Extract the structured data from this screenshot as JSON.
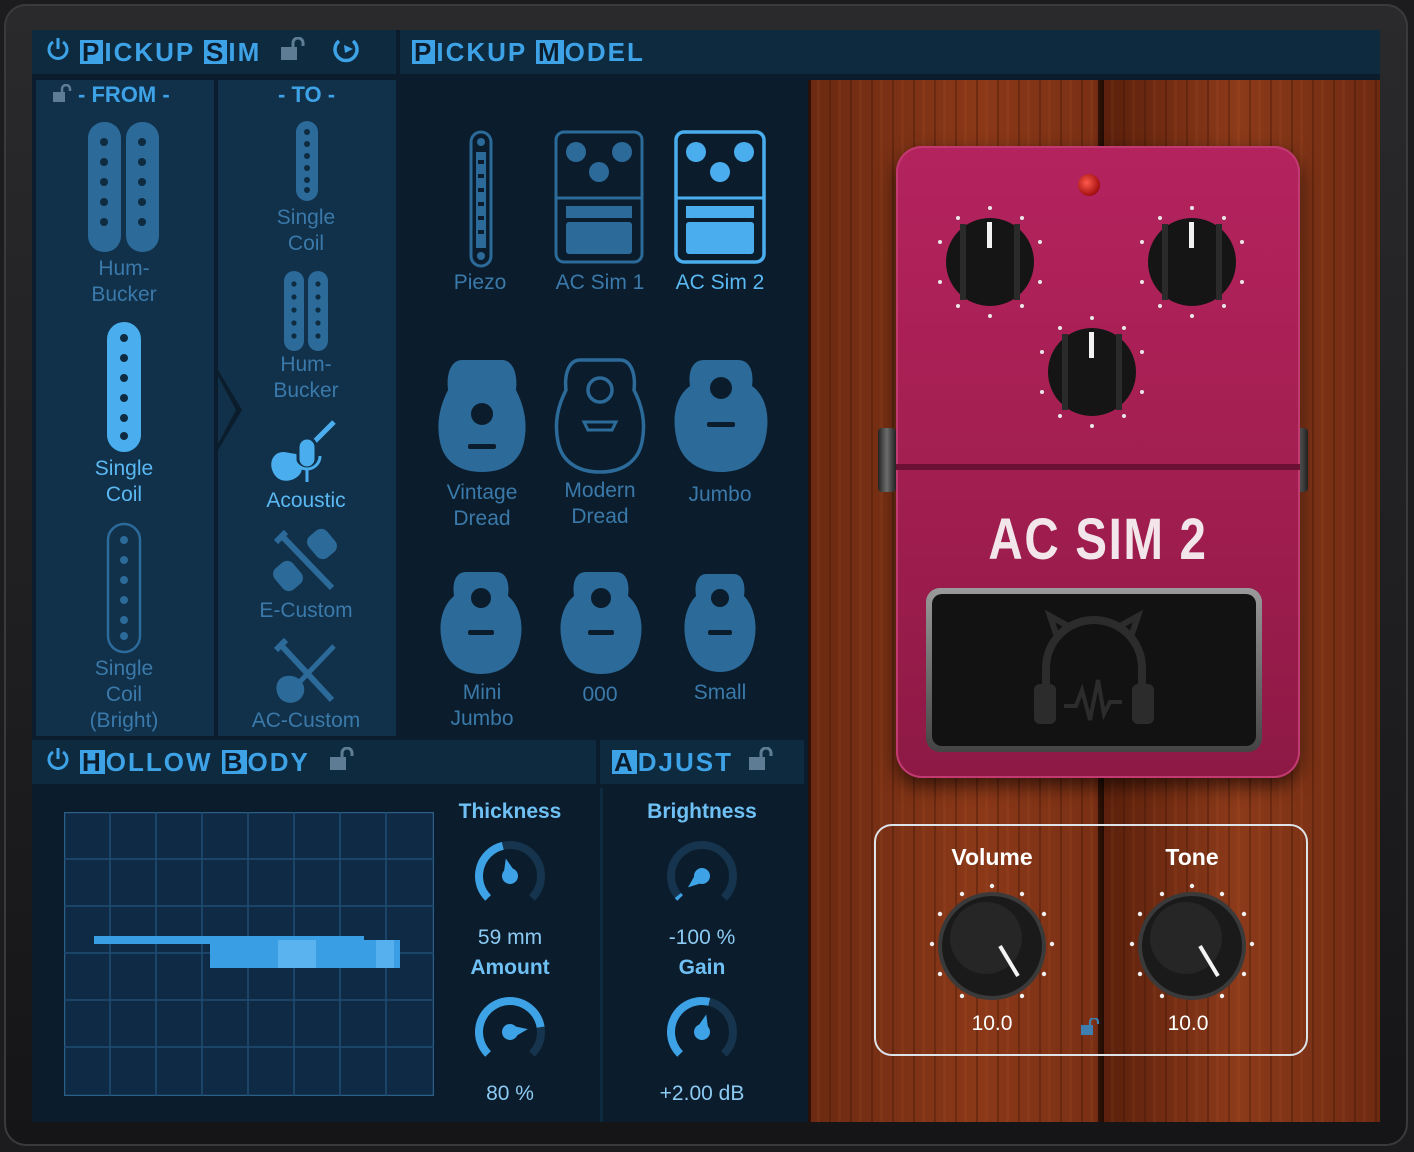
{
  "pickup_sim": {
    "title_cap1": "P",
    "title_rest1": "ICKUP ",
    "title_cap2": "S",
    "title_rest2": "IM",
    "from_label": "- FROM -",
    "to_label": "- TO -",
    "from_items": [
      {
        "label_line1": "Hum-",
        "label_line2": "Bucker",
        "selected": false
      },
      {
        "label_line1": "Single",
        "label_line2": "Coil",
        "selected": true
      },
      {
        "label_line1": "Single",
        "label_line2": "Coil",
        "label_line3": "(Bright)",
        "selected": false
      }
    ],
    "to_items": [
      {
        "label_line1": "Single",
        "label_line2": "Coil",
        "selected": false
      },
      {
        "label_line1": "Hum-",
        "label_line2": "Bucker",
        "selected": false
      },
      {
        "label_line1": "Acoustic",
        "selected": true
      },
      {
        "label_line1": "E-Custom",
        "selected": false
      },
      {
        "label_line1": "AC-Custom",
        "selected": false
      }
    ]
  },
  "pickup_model": {
    "title_cap1": "P",
    "title_rest1": "ICKUP ",
    "title_cap2": "M",
    "title_rest2": "ODEL",
    "models": [
      {
        "line1": "Piezo",
        "selected": false
      },
      {
        "line1": "AC Sim 1",
        "selected": false
      },
      {
        "line1": "AC Sim 2",
        "selected": true
      },
      {
        "line1": "Vintage",
        "line2": "Dread",
        "selected": false
      },
      {
        "line1": "Modern",
        "line2": "Dread",
        "selected": false
      },
      {
        "line1": "Jumbo",
        "selected": false
      },
      {
        "line1": "Mini",
        "line2": "Jumbo",
        "selected": false
      },
      {
        "line1": "000",
        "selected": false
      },
      {
        "line1": "Small",
        "selected": false
      }
    ]
  },
  "hollow_body": {
    "title_cap1": "H",
    "title_rest1": "OLLOW ",
    "title_cap2": "B",
    "title_rest2": "ODY",
    "thickness_label": "Thickness",
    "thickness_value": "59 mm",
    "thickness_level": 0.45,
    "amount_label": "Amount",
    "amount_value": "80 %",
    "amount_level": 0.8
  },
  "adjust": {
    "title_cap1": "A",
    "title_rest1": "DJUST",
    "brightness_label": "Brightness",
    "brightness_value": "-100 %",
    "brightness_level": 0.0,
    "gain_label": "Gain",
    "gain_value": "+2.00 dB",
    "gain_level": 0.55
  },
  "pedal": {
    "name": "AC SIM 2",
    "volume_label": "Volume",
    "volume_value": "10.0",
    "tone_label": "Tone",
    "tone_value": "10.0",
    "color": "#a51f52"
  },
  "colors": {
    "accent": "#3ea2e6",
    "dim": "#3a79a9",
    "selected": "#5ab8f2"
  }
}
